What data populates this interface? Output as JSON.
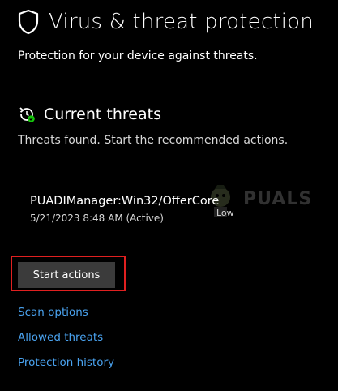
{
  "header": {
    "title": "Virus & threat protection",
    "icon": "shield-icon"
  },
  "subtitle": "Protection for your device against threats.",
  "current_threats": {
    "title": "Current threats",
    "icon": "threats-history-icon",
    "status_color": "#16c60c",
    "description": "Threats found. Start the recommended actions.",
    "items": [
      {
        "name": "PUADIManager:Win32/OfferCore",
        "date": "5/21/2023 8:48 AM (Active)",
        "severity": "Low"
      }
    ],
    "action_button": "Start actions",
    "highlight_color": "#e02020"
  },
  "watermark": {
    "text": "PUALS"
  },
  "links": {
    "scan_options": "Scan options",
    "allowed_threats": "Allowed threats",
    "protection_history": "Protection history",
    "color": "#4aa3f0"
  }
}
